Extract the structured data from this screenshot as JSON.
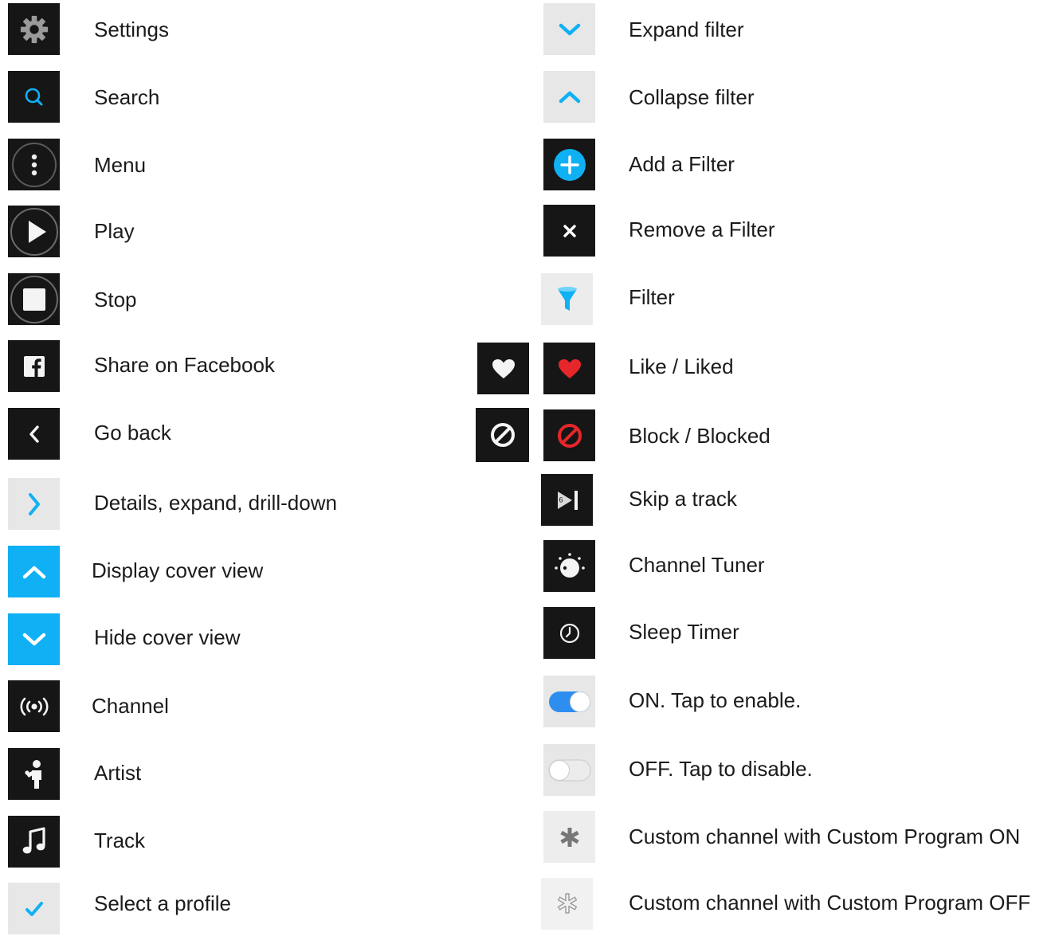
{
  "left_column": {
    "items": [
      {
        "label": "Settings",
        "icon": "gear-icon"
      },
      {
        "label": "Search",
        "icon": "search-icon"
      },
      {
        "label": "Menu",
        "icon": "menu-dots-icon"
      },
      {
        "label": "Play",
        "icon": "play-icon"
      },
      {
        "label": "Stop",
        "icon": "stop-icon"
      },
      {
        "label": "Share on Facebook",
        "icon": "facebook-icon"
      },
      {
        "label": "Go back",
        "icon": "chevron-left-icon"
      },
      {
        "label": "Details, expand, drill-down",
        "icon": "chevron-right-icon"
      },
      {
        "label": "Display cover view",
        "icon": "chevron-up-icon"
      },
      {
        "label": "Hide cover view",
        "icon": "chevron-down-icon"
      },
      {
        "label": "Channel",
        "icon": "radio-waves-icon"
      },
      {
        "label": "Artist",
        "icon": "artist-icon"
      },
      {
        "label": "Track",
        "icon": "music-note-icon"
      },
      {
        "label": "Select a profile",
        "icon": "check-icon"
      }
    ]
  },
  "right_column": {
    "items": [
      {
        "label": "Expand filter",
        "icon": "chevron-down-icon"
      },
      {
        "label": "Collapse filter",
        "icon": "chevron-up-icon"
      },
      {
        "label": "Add a Filter",
        "icon": "plus-circle-icon"
      },
      {
        "label": "Remove a Filter",
        "icon": "close-icon"
      },
      {
        "label": "Filter",
        "icon": "funnel-icon"
      },
      {
        "label": "Like / Liked",
        "icon": "heart-icon"
      },
      {
        "label": "Block / Blocked",
        "icon": "block-icon"
      },
      {
        "label": "Skip a track",
        "icon": "skip-icon"
      },
      {
        "label": "Channel Tuner",
        "icon": "tuner-knob-icon"
      },
      {
        "label": "Sleep Timer",
        "icon": "clock-icon"
      },
      {
        "label": "ON. Tap to enable.",
        "icon": "toggle-on-icon"
      },
      {
        "label": "OFF. Tap to disable.",
        "icon": "toggle-off-icon"
      },
      {
        "label": "Custom channel with Custom Program ON",
        "icon": "asterisk-icon"
      },
      {
        "label": "Custom channel with Custom Program OFF",
        "icon": "asterisk-outline-icon"
      }
    ]
  },
  "colors": {
    "accent_blue": "#0fb0f4",
    "dark_tile": "#161616",
    "light_tile": "#e7e7e7",
    "liked_red": "#e5262a",
    "toggle_blue": "#2d8ef0"
  },
  "skip_icon_glyph": "6"
}
